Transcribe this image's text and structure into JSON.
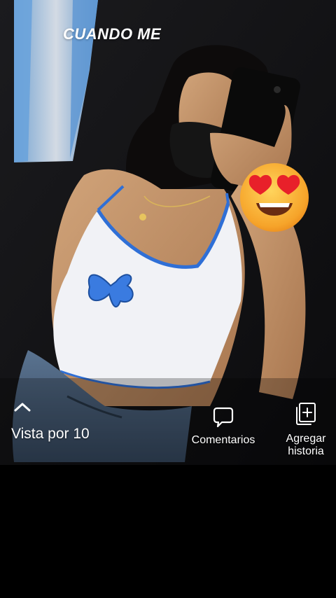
{
  "story": {
    "caption": "CUANDO ME",
    "sticker_icon": "heart-eyes-emoji"
  },
  "footer": {
    "viewers_label": "Vista por 10",
    "viewers_icon": "chevron-up-icon",
    "comments_label": "Comentarios",
    "comments_icon": "comment-bubble-icon",
    "add_story_label": "Agregar\nhistoria",
    "add_story_icon": "add-story-icon"
  },
  "colors": {
    "background": "#000000",
    "text": "#ffffff",
    "accent_blue": "#2f6fd6"
  }
}
